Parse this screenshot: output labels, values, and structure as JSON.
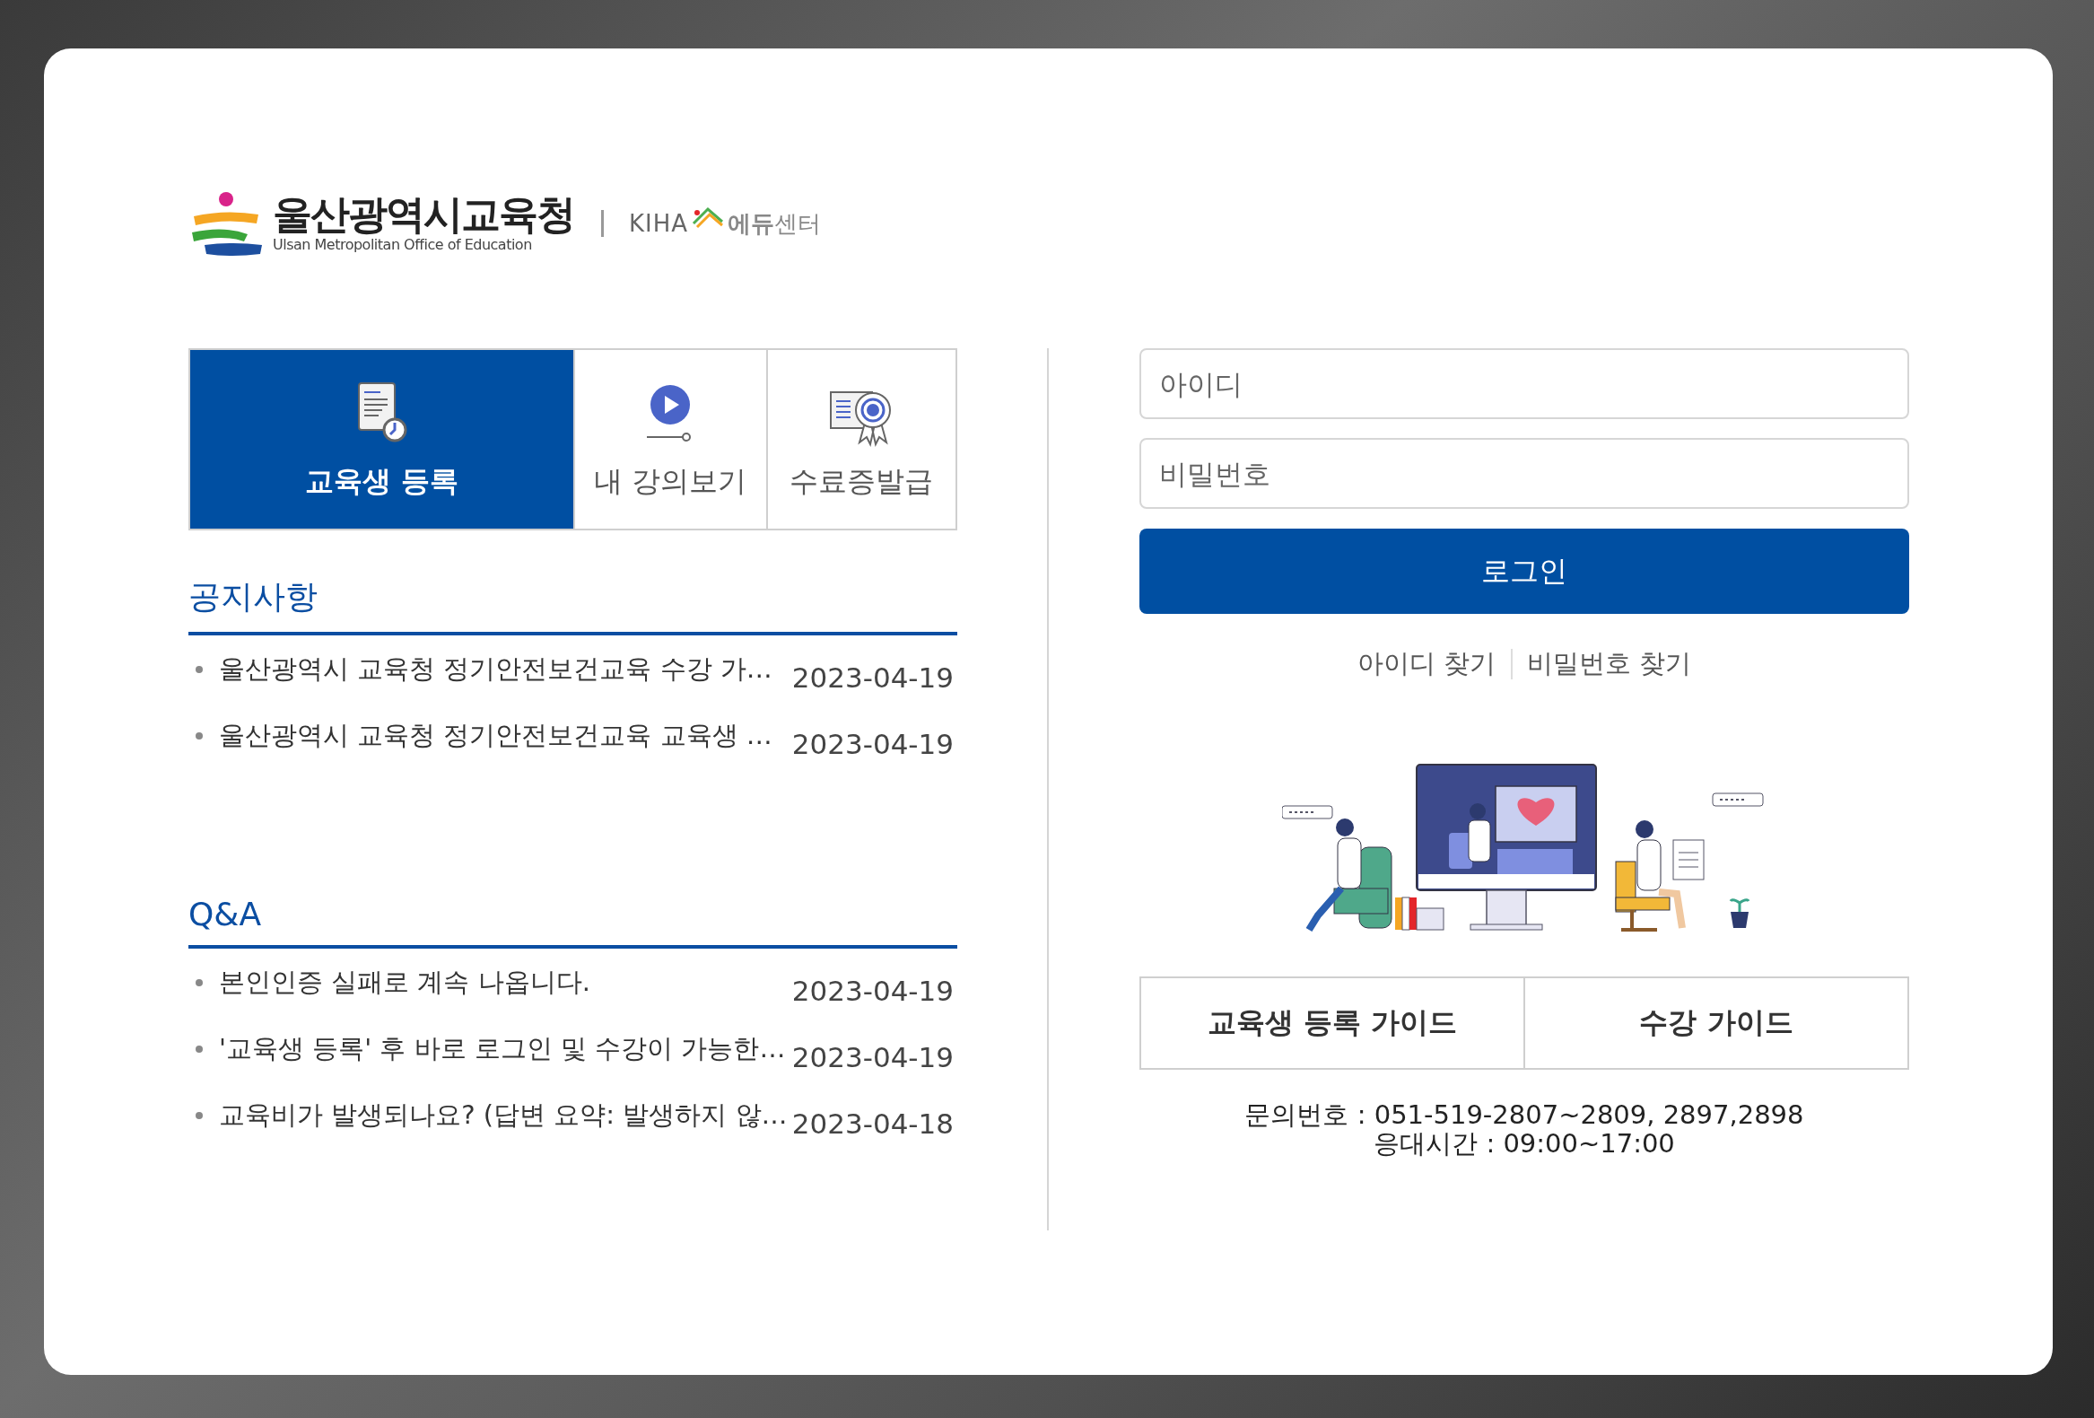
{
  "logo": {
    "name": "울산광역시교육청",
    "subtitle": "Ulsan Metropolitan Office of Education",
    "partner": "KIHA",
    "partner_name": "**에듀**센터"
  },
  "tabs": [
    {
      "label": "교육생 등록",
      "selected": true,
      "kind": "register"
    },
    {
      "label": "내 강의보기",
      "selected": false,
      "kind": "lectures"
    },
    {
      "label": "수료증발급",
      "selected": false,
      "kind": "certificate"
    }
  ],
  "notices": {
    "title": "공지사항",
    "items": [
      {
        "title": "울산광역시 교육청 정기안전보건교육 수강 가…",
        "date": "2023-04-19"
      },
      {
        "title": "울산광역시 교육청 정기안전보건교육 교육생 …",
        "date": "2023-04-19"
      }
    ]
  },
  "qna": {
    "title": "Q&A",
    "items": [
      {
        "title": "본인인증 실패로 계속 나옵니다.",
        "date": "2023-04-19"
      },
      {
        "title": "'교육생 등록' 후 바로 로그인 및 수강이 가능한…",
        "date": "2023-04-19"
      },
      {
        "title": "교육비가 발생되나요? (답변 요약: 발생하지 않…",
        "date": "2023-04-18"
      }
    ]
  },
  "login": {
    "id_placeholder": "아이디",
    "password_placeholder": "비밀번호",
    "button": "로그인",
    "links": [
      "아이디 찾기",
      "비밀번호 찾기"
    ]
  },
  "guides": [
    "교육생 등록 가이드",
    "수강 가이드"
  ],
  "contact": [
    "문의번호 : 051-519-2807~2809, 2897,2898",
    "응대시간 : 09:00~17:00"
  ]
}
